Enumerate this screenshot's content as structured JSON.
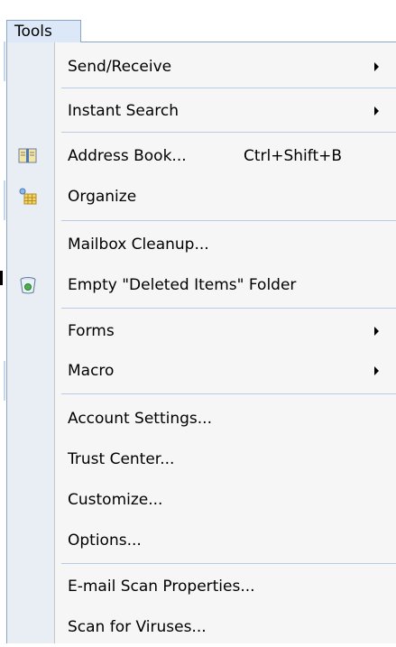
{
  "menubar": {
    "tools_label": "Tools"
  },
  "menu": {
    "items": [
      {
        "label": "Send/Receive",
        "shortcut": "",
        "submenu": true,
        "icon": ""
      },
      {
        "label": "Instant Search",
        "shortcut": "",
        "submenu": true,
        "icon": ""
      },
      {
        "label": "Address Book...",
        "shortcut": "Ctrl+Shift+B",
        "submenu": false,
        "icon": "address-book-icon"
      },
      {
        "label": "Organize",
        "shortcut": "",
        "submenu": false,
        "icon": "organize-icon"
      },
      {
        "label": "Mailbox Cleanup...",
        "shortcut": "",
        "submenu": false,
        "icon": ""
      },
      {
        "label": "Empty \"Deleted Items\" Folder",
        "shortcut": "",
        "submenu": false,
        "icon": "recycle-bin-icon"
      },
      {
        "label": "Forms",
        "shortcut": "",
        "submenu": true,
        "icon": ""
      },
      {
        "label": "Macro",
        "shortcut": "",
        "submenu": true,
        "icon": ""
      },
      {
        "label": "Account Settings...",
        "shortcut": "",
        "submenu": false,
        "icon": ""
      },
      {
        "label": "Trust Center...",
        "shortcut": "",
        "submenu": false,
        "icon": ""
      },
      {
        "label": "Customize...",
        "shortcut": "",
        "submenu": false,
        "icon": ""
      },
      {
        "label": "Options...",
        "shortcut": "",
        "submenu": false,
        "icon": ""
      },
      {
        "label": "E-mail Scan Properties...",
        "shortcut": "",
        "submenu": false,
        "icon": ""
      },
      {
        "label": "Scan for Viruses...",
        "shortcut": "",
        "submenu": false,
        "icon": ""
      }
    ]
  },
  "colors": {
    "menu_background": "#f6f6f6",
    "gutter": "#e9eef5",
    "separator": "#b8cbe4",
    "tab_highlight": "#dce8f7"
  }
}
